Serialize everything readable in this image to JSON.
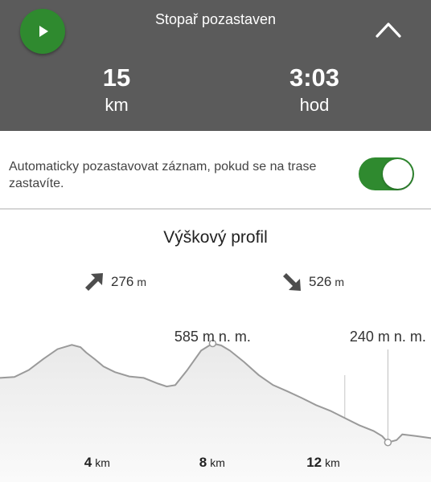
{
  "header": {
    "status_text": "Stopař pozastaven",
    "play_icon": "play-icon",
    "collapse_icon": "chevron-up-icon",
    "distance": {
      "value": "15",
      "unit": "km"
    },
    "duration": {
      "value": "3:03",
      "unit": "hod"
    },
    "colors": {
      "background": "#5b5b5b",
      "play": "#2f8a2f"
    }
  },
  "autopause": {
    "text": "Automaticky pozastavovat záznam, pokud se na trase zastavíte.",
    "enabled": true,
    "toggle_color": "#2f8a2f"
  },
  "profile": {
    "title": "Výškový profil",
    "ascent": {
      "value": "276",
      "unit": "m",
      "icon": "arrow-up-right-icon"
    },
    "descent": {
      "value": "526",
      "unit": "m",
      "icon": "arrow-down-right-icon"
    },
    "max_label": "585 m n. m.",
    "min_label": "240 m n. m.",
    "distance_ticks": [
      {
        "value": "4",
        "unit": "km",
        "km": 4
      },
      {
        "value": "8",
        "unit": "km",
        "km": 8
      },
      {
        "value": "12",
        "unit": "km",
        "km": 12
      }
    ]
  },
  "chart_data": {
    "type": "area",
    "xlabel": "",
    "ylabel": "",
    "xlim": [
      0,
      15
    ],
    "ylim": [
      200,
      620
    ],
    "x": [
      0,
      0.5,
      1,
      1.5,
      2,
      2.5,
      2.8,
      3,
      3.3,
      3.6,
      4,
      4.5,
      5,
      5.5,
      5.8,
      6.1,
      6.5,
      7,
      7.4,
      7.7,
      8,
      8.5,
      9,
      9.5,
      10,
      10.5,
      11,
      11.5,
      12,
      12.5,
      13,
      13.3,
      13.5,
      13.8,
      14,
      14.5,
      15
    ],
    "y": [
      465,
      468,
      492,
      530,
      565,
      580,
      572,
      553,
      530,
      505,
      485,
      470,
      465,
      445,
      435,
      440,
      490,
      560,
      585,
      578,
      560,
      520,
      475,
      440,
      418,
      395,
      370,
      350,
      325,
      300,
      280,
      262,
      240,
      248,
      268,
      262,
      255
    ],
    "max_point": {
      "x": 7.4,
      "y": 585
    },
    "min_point": {
      "x": 13.5,
      "y": 240
    }
  }
}
